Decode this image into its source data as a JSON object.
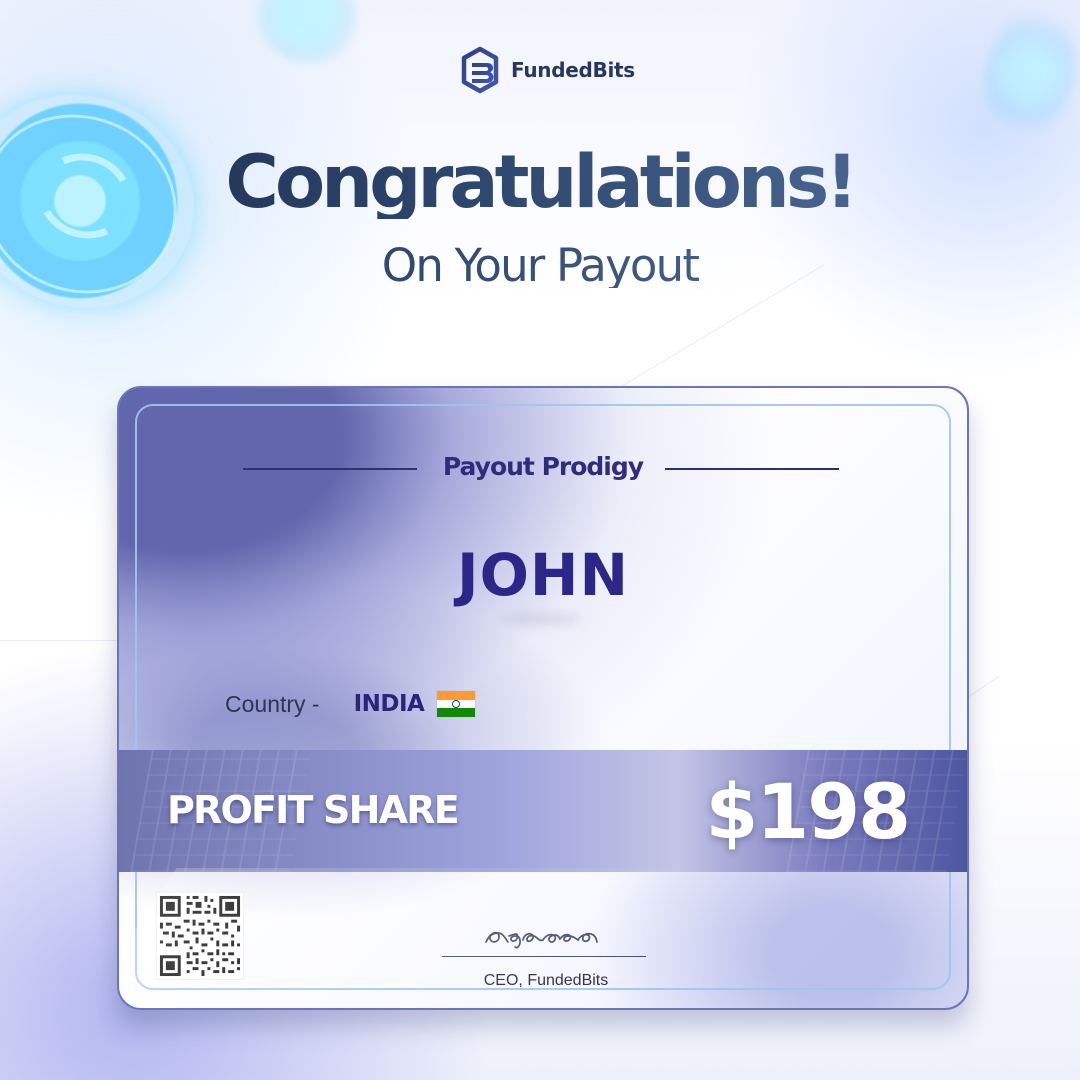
{
  "brand": {
    "name": "FundedBits",
    "logo_icon": "fundedbits-logo-icon",
    "accent_color": "#2f2c7d"
  },
  "hero": {
    "title": "Congratulations!",
    "subtitle": "On Your Payout"
  },
  "certificate": {
    "title": "Payout Prodigy",
    "recipient_name": "JOHN",
    "country_label": "Country -",
    "country_value": "INDIA",
    "flag_icon": "india-flag-icon",
    "profit_label": "PROFIT SHARE",
    "profit_amount": "$198",
    "signature_caption": "CEO, FundedBits",
    "qr_icon": "qr-code-icon"
  }
}
